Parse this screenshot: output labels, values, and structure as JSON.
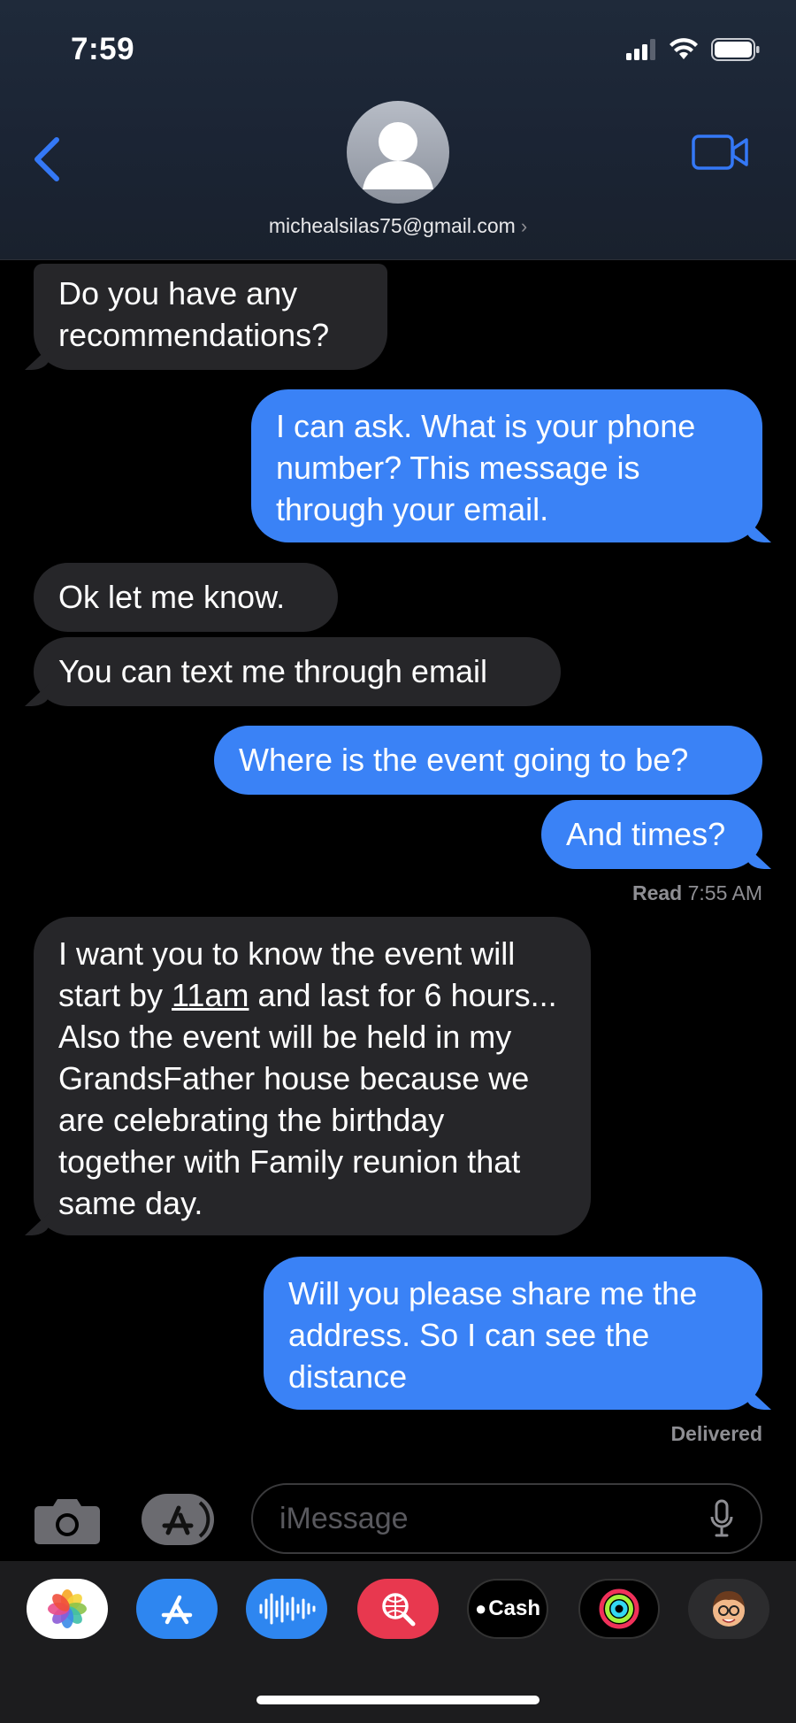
{
  "status_bar": {
    "time": "7:59"
  },
  "header": {
    "contact": "michealsilas75@gmail.com"
  },
  "messages": [
    {
      "from": "them",
      "text": "Do you have any recommendations?"
    },
    {
      "from": "me",
      "text": "I can ask. What is your phone number? This message is through your email."
    },
    {
      "from": "them",
      "text": "Ok let me know."
    },
    {
      "from": "them",
      "text": "You can text me through email"
    },
    {
      "from": "me",
      "text": "Where is the event going to be?"
    },
    {
      "from": "me",
      "text": "And times?"
    },
    {
      "from": "them",
      "text_before": "I want you to know the event will start by ",
      "link": "11am",
      "text_after": " and last for 6 hours... Also the event will be held in my GrandsFather house because we are celebrating the birthday together with Family reunion that same day."
    },
    {
      "from": "me",
      "text": "Will you please share me the address. So I can see the distance"
    }
  ],
  "receipts": {
    "read_label": "Read",
    "read_time": "7:55 AM",
    "delivered": "Delivered"
  },
  "composer": {
    "placeholder": "iMessage"
  },
  "app_tray": {
    "items": [
      "photos-icon",
      "app-store-icon",
      "audio-message-icon",
      "image-search-icon",
      "apple-cash-icon",
      "activity-icon",
      "memoji-icon"
    ],
    "cash_label": "Cash"
  },
  "colors": {
    "outgoing": "#3a82f6",
    "incoming": "#262629",
    "accent": "#3478f6"
  }
}
